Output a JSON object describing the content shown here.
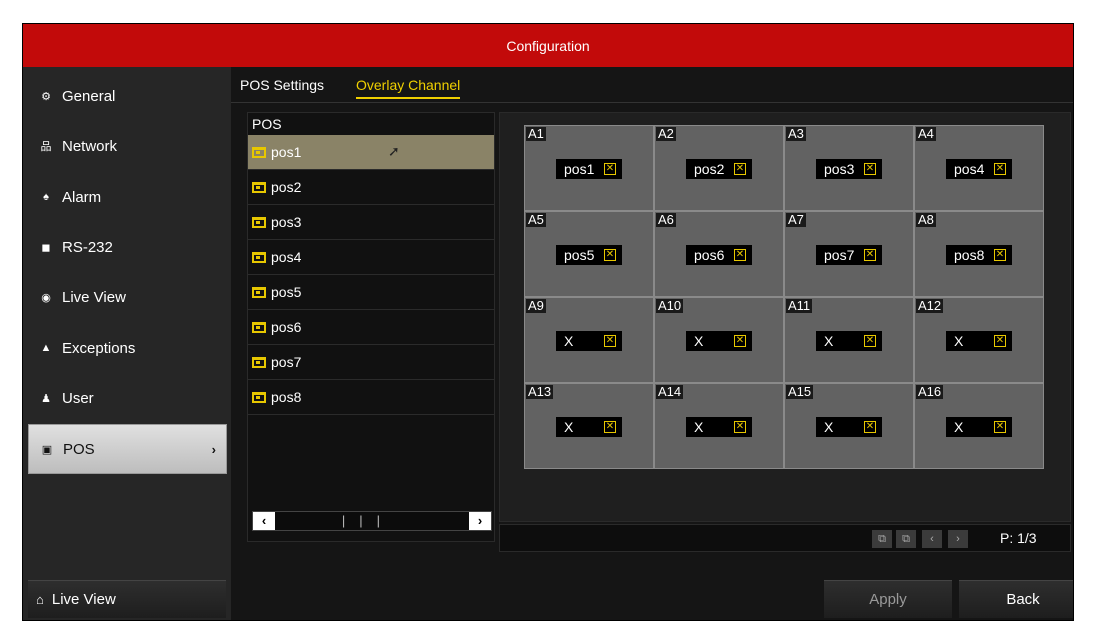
{
  "window": {
    "title": "Configuration"
  },
  "sidebar": {
    "items": [
      {
        "label": "General",
        "icon": "gear-icon",
        "glyph": "⚙"
      },
      {
        "label": "Network",
        "icon": "network-icon",
        "glyph": "品"
      },
      {
        "label": "Alarm",
        "icon": "alarm-icon",
        "glyph": "♠"
      },
      {
        "label": "RS-232",
        "icon": "rs232-icon",
        "glyph": "◼"
      },
      {
        "label": "Live View",
        "icon": "eye-icon",
        "glyph": "◉"
      },
      {
        "label": "Exceptions",
        "icon": "warning-icon",
        "glyph": "▲"
      },
      {
        "label": "User",
        "icon": "users-icon",
        "glyph": "♟"
      },
      {
        "label": "POS",
        "icon": "pos-icon",
        "glyph": "▣",
        "active": true
      }
    ],
    "live_view_button": {
      "label": "Live View",
      "icon": "home-icon",
      "glyph": "⌂"
    }
  },
  "tabs": [
    {
      "label": "POS Settings",
      "active": false
    },
    {
      "label": "Overlay Channel",
      "active": true
    }
  ],
  "pos_list": {
    "header": "POS",
    "items": [
      "pos1",
      "pos2",
      "pos3",
      "pos4",
      "pos5",
      "pos6",
      "pos7",
      "pos8"
    ],
    "selected": "pos1"
  },
  "overlay_grid": {
    "cells": [
      {
        "label": "A1",
        "value": "pos1"
      },
      {
        "label": "A2",
        "value": "pos2"
      },
      {
        "label": "A3",
        "value": "pos3"
      },
      {
        "label": "A4",
        "value": "pos4"
      },
      {
        "label": "A5",
        "value": "pos5"
      },
      {
        "label": "A6",
        "value": "pos6"
      },
      {
        "label": "A7",
        "value": "pos7"
      },
      {
        "label": "A8",
        "value": "pos8"
      },
      {
        "label": "A9",
        "value": "X"
      },
      {
        "label": "A10",
        "value": "X"
      },
      {
        "label": "A11",
        "value": "X"
      },
      {
        "label": "A12",
        "value": "X"
      },
      {
        "label": "A13",
        "value": "X"
      },
      {
        "label": "A14",
        "value": "X"
      },
      {
        "label": "A15",
        "value": "X"
      },
      {
        "label": "A16",
        "value": "X"
      }
    ]
  },
  "pager": {
    "page": "P: 1/3"
  },
  "buttons": {
    "apply": "Apply",
    "back": "Back"
  },
  "colors": {
    "titlebar": "#c20a0a",
    "accent": "#f0d000",
    "selected_row": "#8a8367"
  }
}
